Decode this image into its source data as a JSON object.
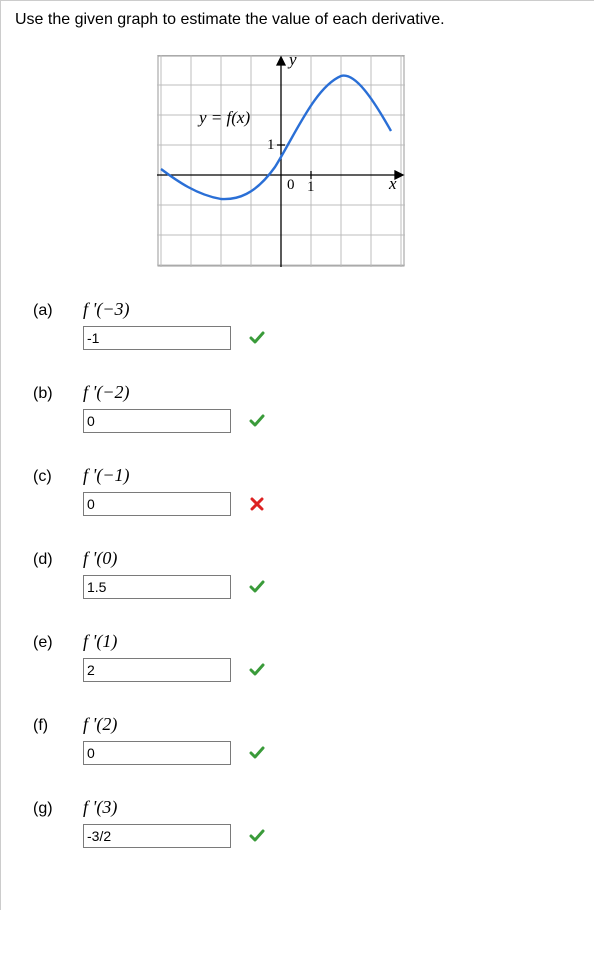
{
  "question_text": "Use the given graph to estimate the value of each derivative.",
  "graph": {
    "y_label": "y",
    "x_label": "x",
    "origin_label": "0",
    "x_tick": "1",
    "y_tick": "1",
    "curve_label": "y = f(x)"
  },
  "parts": [
    {
      "letter": "(a)",
      "prompt": "f '(−3)",
      "value": "-1",
      "mark": "correct"
    },
    {
      "letter": "(b)",
      "prompt": "f '(−2)",
      "value": "0",
      "mark": "correct"
    },
    {
      "letter": "(c)",
      "prompt": "f '(−1)",
      "value": "0",
      "mark": "incorrect"
    },
    {
      "letter": "(d)",
      "prompt": "f '(0)",
      "value": "1.5",
      "mark": "correct"
    },
    {
      "letter": "(e)",
      "prompt": "f '(1)",
      "value": "2",
      "mark": "correct"
    },
    {
      "letter": "(f)",
      "prompt": "f '(2)",
      "value": "0",
      "mark": "correct"
    },
    {
      "letter": "(g)",
      "prompt": "f '(3)",
      "value": "-3/2",
      "mark": "correct"
    }
  ],
  "icons": {
    "info": "info-icon",
    "correct": "check-icon",
    "incorrect": "x-icon"
  },
  "chart_data": {
    "type": "line",
    "title": "",
    "xlabel": "x",
    "ylabel": "y",
    "curve_label": "y = f(x)",
    "xlim": [
      -4,
      4
    ],
    "ylim": [
      -3,
      4
    ],
    "x": [
      -4,
      -3,
      -2,
      -1,
      0,
      1,
      2,
      3,
      4
    ],
    "y": [
      0.2,
      -0.4,
      -0.8,
      -0.4,
      0.4,
      2.1,
      3.3,
      2.3,
      1.4
    ],
    "derivative_estimates": [
      {
        "x": -3,
        "fprime": -1
      },
      {
        "x": -2,
        "fprime": 0
      },
      {
        "x": -1,
        "fprime": 1
      },
      {
        "x": 0,
        "fprime": 1.5
      },
      {
        "x": 1,
        "fprime": 2
      },
      {
        "x": 2,
        "fprime": 0
      },
      {
        "x": 3,
        "fprime": -1.5
      }
    ]
  }
}
